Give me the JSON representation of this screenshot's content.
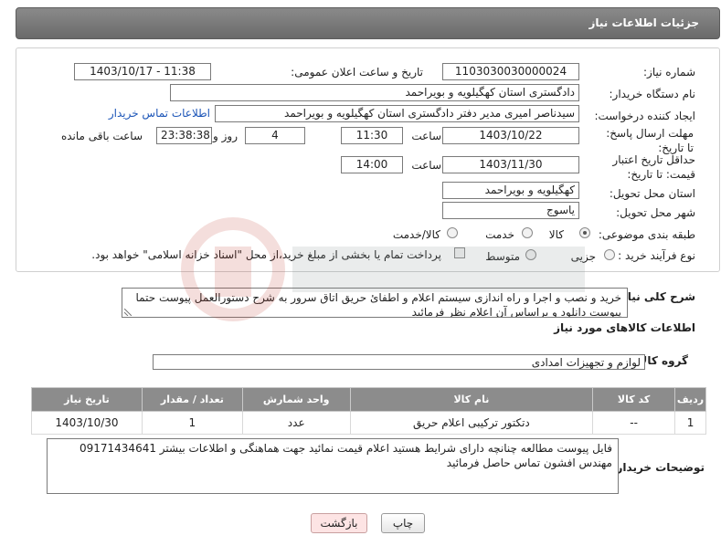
{
  "header": {
    "title": "جزئیات اطلاعات نیاز"
  },
  "fields": {
    "need_number_label": "شماره نیاز:",
    "need_number": "1103030030000024",
    "announce_label": "تاریخ و ساعت اعلان عمومی:",
    "announce_value": "1403/10/17 - 11:38",
    "buyer_org_label": "نام دستگاه خریدار:",
    "buyer_org": "دادگستری استان کهگیلویه و بویراحمد",
    "creator_label": "ایجاد کننده درخواست:",
    "creator": "سیدناصر امیری مدیر دفتر دادگستری استان کهگیلویه و بویراحمد",
    "buyer_contact_link": "اطلاعات تماس خریدار",
    "reply_deadline_label": "مهلت ارسال پاسخ: تا تاریخ:",
    "reply_date": "1403/10/22",
    "time_label": "ساعت",
    "reply_time": "11:30",
    "days_value": "4",
    "days_label": "روز و",
    "remaining_time": "23:38:38",
    "remaining_label": "ساعت باقی مانده",
    "price_validity_label": "حداقل تاریخ اعتبار قیمت: تا تاریخ:",
    "price_date": "1403/11/30",
    "price_time": "14:00",
    "province_label": "استان محل تحویل:",
    "province": "کهگیلویه و بویراحمد",
    "city_label": "شهر محل تحویل:",
    "city": "یاسوج",
    "category_label": "طبقه بندی موضوعی:",
    "category_options": [
      "کالا",
      "خدمت",
      "کالا/خدمت"
    ],
    "category_selected": "کالا",
    "process_label": "نوع فرآیند خرید :",
    "process_options": [
      "جزیی",
      "متوسط"
    ],
    "process_selected": "",
    "payment_note": "پرداخت تمام یا بخشی از مبلغ خرید،از محل \"اسناد خزانه اسلامی\" خواهد بود."
  },
  "summary": {
    "label": "شرح کلی نیاز:",
    "text": "خرید و نصب و اجرا و راه اندازی سیستم اعلام و اطفائ حریق اتاق سرور به شرح دستورالعمل پیوست حتما پیوست دانلود و براساس آن اعلام نظر فرمائید"
  },
  "goods": {
    "section_title": "اطلاعات کالاهای مورد نیاز",
    "group_label": "گروه کالا:",
    "group_value": "لوازم و تجهیزات امدادی",
    "columns": [
      "ردیف",
      "کد کالا",
      "نام کالا",
      "واحد شمارش",
      "تعداد / مقدار",
      "تاریخ نیاز"
    ],
    "rows": [
      [
        "1",
        "--",
        "دتکتور ترکیبی اعلام حریق",
        "عدد",
        "1",
        "1403/10/30"
      ]
    ]
  },
  "buyer_notes": {
    "label": "توضیحات خریدار:",
    "line1": "فایل پیوست مطالعه چنانچه دارای شرایط هستید اعلام قیمت نمائید جهت هماهنگی و اطلاعات بیشتر 09171434641",
    "line2": "مهندس افشون تماس حاصل فرمائید"
  },
  "buttons": {
    "print": "چاپ",
    "back": "بازگشت"
  },
  "colors": {
    "header_bg": "#7a7a7a",
    "table_header_bg": "#8c8c8c",
    "link": "#1d56b8",
    "back_button_bg": "#fde4e4"
  }
}
